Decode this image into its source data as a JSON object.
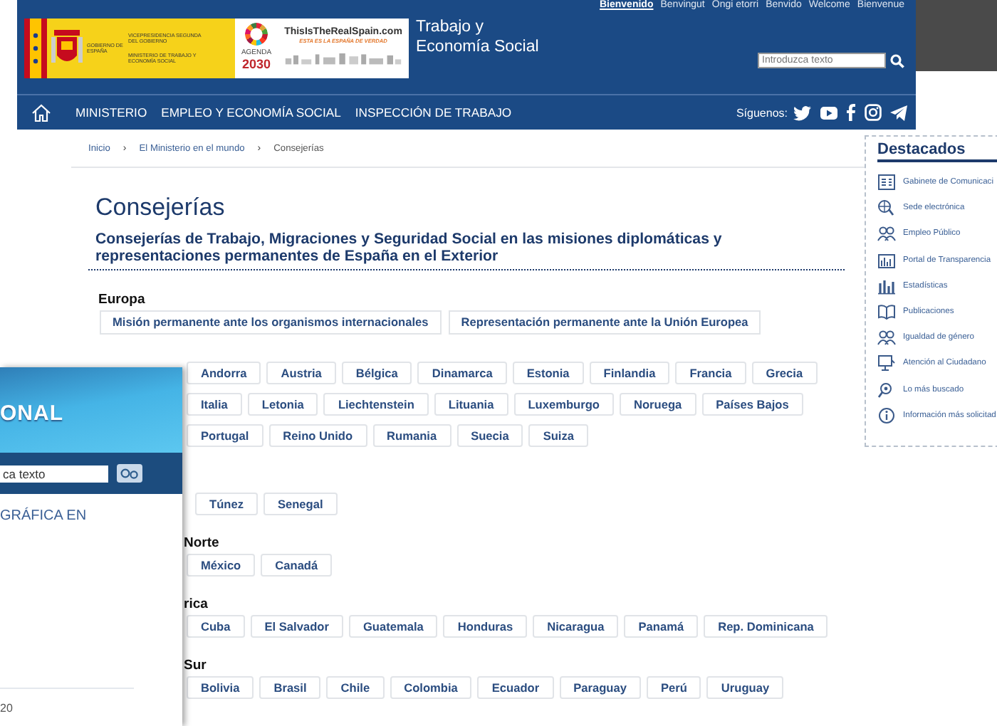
{
  "header": {
    "language_links": [
      {
        "label": "Bienvenido",
        "selected": true
      },
      {
        "label": "Benvingut",
        "selected": false
      },
      {
        "label": "Ongi etorri",
        "selected": false
      },
      {
        "label": "Benvido",
        "selected": false
      },
      {
        "label": "Welcome",
        "selected": false
      },
      {
        "label": "Bienvenue",
        "selected": false
      }
    ],
    "logo": {
      "government": "GOBIERNO DE ESPAÑA",
      "vicepresidency": "VICEPRESIDENCIA SEGUNDA DEL GOBIERNO",
      "ministry": "MINISTERIO DE TRABAJO Y ECONOMÍA SOCIAL",
      "agenda_label": "AGENDA",
      "agenda_year": "2030",
      "campaign": "ThisIsTheRealSpain.com",
      "campaign_tagline": "ESTA ES LA ESPAÑA DE VERDAD"
    },
    "site_title": [
      "Trabajo y",
      "Economía Social"
    ],
    "search": {
      "placeholder": "Introduzca texto"
    }
  },
  "nav": {
    "items": [
      "MINISTERIO",
      "EMPLEO Y ECONOMÍA SOCIAL",
      "INSPECCIÓN DE TRABAJO"
    ],
    "follow_label": "Síguenos:"
  },
  "breadcrumb": {
    "items": [
      "Inicio",
      "El Ministerio en el mundo",
      "Consejerías"
    ],
    "separator": "›"
  },
  "page_title": "Consejerías",
  "subtitle": "Consejerías de Trabajo, Migraciones y Seguridad Social en las misiones diplomáticas  y representaciones permanentes de España en el Exterior",
  "regions": [
    {
      "heading": "Europa",
      "missions": [
        "Misión permanente ante los organismos internacionales",
        "Representación permanente ante la Unión Europea"
      ],
      "rows": [
        [
          "Andorra",
          "Austria",
          "Bélgica",
          "Dinamarca",
          "Estonia",
          "Finlandia",
          "Francia",
          "Grecia"
        ],
        [
          "Italia",
          "Letonia",
          "Liechtenstein",
          "Lituania",
          "Luxemburgo",
          "Noruega",
          "Países Bajos"
        ],
        [
          "Portugal",
          "Reino Unido",
          "Rumania",
          "Suecia",
          "Suiza"
        ]
      ]
    },
    {
      "rows": [
        [
          "Túnez",
          "Senegal"
        ]
      ]
    },
    {
      "heading": "Norte",
      "rows": [
        [
          "México",
          "Canadá"
        ]
      ]
    },
    {
      "heading": "rica",
      "rows": [
        [
          "Cuba",
          "El Salvador",
          "Guatemala",
          "Honduras",
          "Nicaragua",
          "Panamá",
          "Rep. Dominicana"
        ]
      ]
    },
    {
      "heading": "Sur",
      "rows": [
        [
          "Bolivia",
          "Brasil",
          "Chile",
          "Colombia",
          "Ecuador",
          "Paraguay",
          "Perú",
          "Uruguay"
        ]
      ]
    }
  ],
  "featured": {
    "title": "Destacados",
    "items": [
      "Gabinete de Comunicaci",
      "Sede electrónica",
      "Empleo Público",
      "Portal de Transparencia",
      "Estadísticas",
      "Publicaciones",
      "Igualdad de género",
      "Atención al Ciudadano",
      "Lo más buscado",
      "Información más solicitad"
    ]
  },
  "overlay_window": {
    "banner": "ONAL",
    "search": {
      "placeholder": "ca texto"
    },
    "heading": "GRÁFICA EN",
    "footer": "20"
  }
}
